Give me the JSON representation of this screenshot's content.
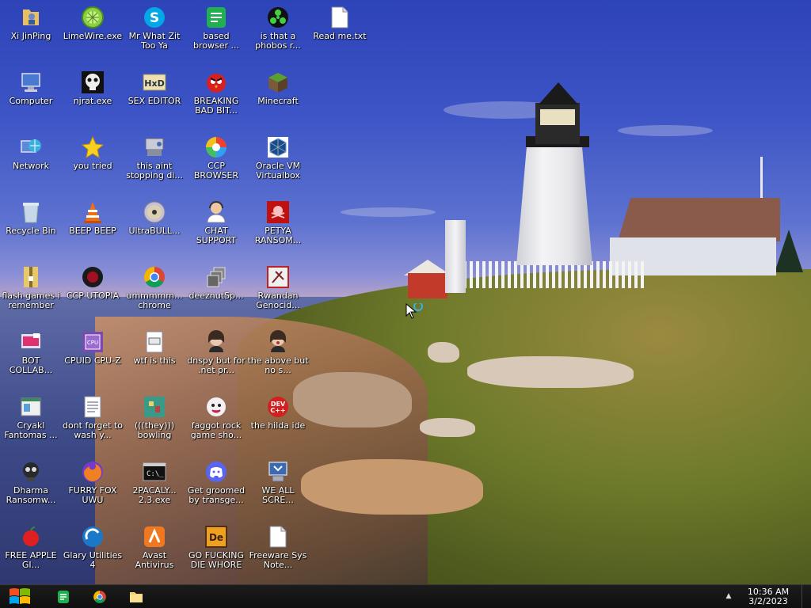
{
  "desktop_icons": [
    {
      "label": "Xi JinPing",
      "icon": "folder-person-icon"
    },
    {
      "label": "LimeWire.exe",
      "icon": "limewire-icon"
    },
    {
      "label": "Mr What Zit Too Ya",
      "icon": "skype-icon"
    },
    {
      "label": "based browser ...",
      "icon": "green-document-icon"
    },
    {
      "label": "is that a phobos r...",
      "icon": "green-biohazard-icon"
    },
    {
      "label": "Read me.txt",
      "icon": "text-file-icon"
    },
    {
      "label": "Computer",
      "icon": "computer-icon"
    },
    {
      "label": "njrat.exe",
      "icon": "skull-icon"
    },
    {
      "label": "SEX EDITOR",
      "icon": "hex-editor-icon"
    },
    {
      "label": "BREAKING BAD BIT...",
      "icon": "angry-bird-icon"
    },
    {
      "label": "Minecraft",
      "icon": "minecraft-icon"
    },
    {
      "label": "Network",
      "icon": "network-globe-icon"
    },
    {
      "label": "you tried",
      "icon": "star-icon"
    },
    {
      "label": "this aint stopping di...",
      "icon": "disk-tool-icon"
    },
    {
      "label": "CCP BROWSER",
      "icon": "color-wheel-icon"
    },
    {
      "label": "Oracle VM Virtualbox",
      "icon": "virtualbox-icon"
    },
    {
      "label": "Recycle Bin",
      "icon": "recycle-bin-icon"
    },
    {
      "label": "BEEP BEEP",
      "icon": "traffic-cone-icon"
    },
    {
      "label": "UltraBULL...",
      "icon": "disc-icon"
    },
    {
      "label": "CHAT SUPPORT",
      "icon": "support-agent-icon"
    },
    {
      "label": "PETYA RANSOM...",
      "icon": "red-skull-icon"
    },
    {
      "label": "flash games i remember",
      "icon": "zip-folder-icon"
    },
    {
      "label": "CCP UTOPIA",
      "icon": "dark-circle-icon"
    },
    {
      "label": "ummmmm... chrome",
      "icon": "chrome-icon"
    },
    {
      "label": "deeznutSp...",
      "icon": "stacked-windows-icon"
    },
    {
      "label": "Rwandan Genocid...",
      "icon": "tool-app-icon"
    },
    {
      "label": "BOT COLLAB...",
      "icon": "paint-folder-icon"
    },
    {
      "label": "CPUID CPU-Z",
      "icon": "cpuz-icon"
    },
    {
      "label": "wtf is this",
      "icon": "settings-file-icon"
    },
    {
      "label": "dnspy but for .net pr...",
      "icon": "face-portrait-icon"
    },
    {
      "label": "the above but no s...",
      "icon": "face-portrait-icon"
    },
    {
      "label": "Cryakl Fantomas ...",
      "icon": "window-app-icon"
    },
    {
      "label": "dont forget to wash y...",
      "icon": "notepad-file-icon"
    },
    {
      "label": "(((they))) bowling",
      "icon": "pixel-game-icon"
    },
    {
      "label": "faggot rock game sho...",
      "icon": "cartoon-face-icon"
    },
    {
      "label": "the hilda ide",
      "icon": "devcpp-icon"
    },
    {
      "label": "Dharma Ransomw...",
      "icon": "dark-skull-icon"
    },
    {
      "label": "FURRY FOX UWU",
      "icon": "firefox-icon"
    },
    {
      "label": "2PACALY... 2.3.exe",
      "icon": "cmd-icon"
    },
    {
      "label": "Get groomed by transge...",
      "icon": "discord-icon"
    },
    {
      "label": "WE ALL SCRE...",
      "icon": "computer-setup-icon"
    },
    {
      "label": "FREE APPLE GI...",
      "icon": "apple-icon"
    },
    {
      "label": "Glary Utilities 4",
      "icon": "glary-icon"
    },
    {
      "label": "Avast Antivirus",
      "icon": "avast-icon"
    },
    {
      "label": "GO FUCKING DIE WHORE",
      "icon": "de-app-icon"
    },
    {
      "label": "Freeware Sys Note...",
      "icon": "blank-file-icon"
    }
  ],
  "taskbar": {
    "apps": [
      {
        "name": "based browser",
        "icon": "green-document-icon"
      },
      {
        "name": "chrome",
        "icon": "chrome-icon"
      },
      {
        "name": "file explorer",
        "icon": "folder-icon"
      }
    ],
    "clock_time": "10:36 AM",
    "clock_date": "3/2/2023"
  },
  "colors": {
    "taskbar": "#121212",
    "label_text": "#ffffff"
  }
}
